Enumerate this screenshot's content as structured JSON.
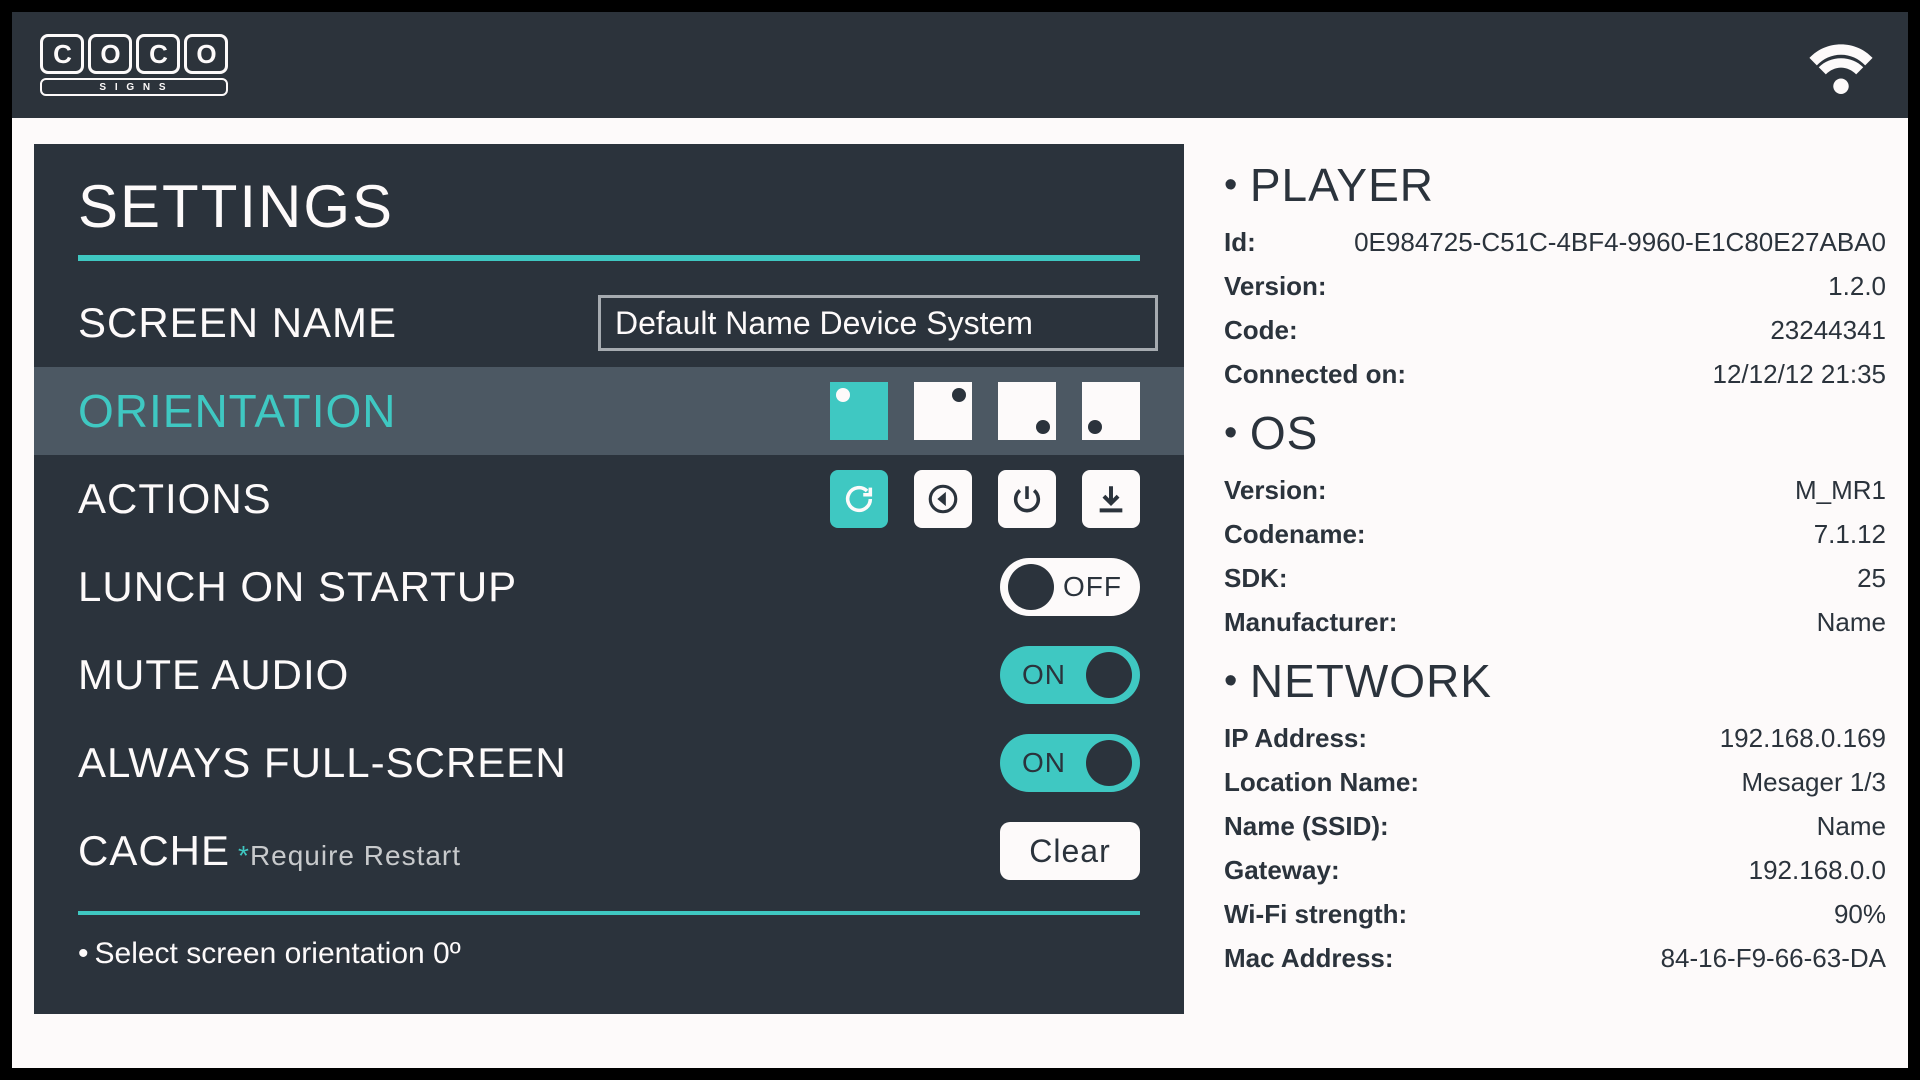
{
  "brand": {
    "letters": [
      "C",
      "O",
      "C",
      "O"
    ],
    "sub": "S I G N S"
  },
  "page": {
    "title": "SETTINGS"
  },
  "screen_name": {
    "label": "SCREEN NAME",
    "value": "Default Name Device System"
  },
  "orientation": {
    "label": "ORIENTATION",
    "selected": 0
  },
  "actions": {
    "label": "ACTIONS"
  },
  "launch": {
    "label": "LUNCH ON STARTUP",
    "state": "OFF"
  },
  "mute": {
    "label": "MUTE AUDIO",
    "state": "ON"
  },
  "fullscreen": {
    "label": "ALWAYS FULL-SCREEN",
    "state": "ON"
  },
  "cache": {
    "label": "CACHE",
    "note": "Require Restart",
    "button": "Clear"
  },
  "hint": "Select screen orientation 0º",
  "toggle_labels": {
    "on": "ON",
    "off": "OFF"
  },
  "info": {
    "player": {
      "heading": "PLAYER",
      "id_k": "Id:",
      "id_v": "0E984725-C51C-4BF4-9960-E1C80E27ABA0",
      "version_k": "Version:",
      "version_v": "1.2.0",
      "code_k": "Code:",
      "code_v": "23244341",
      "connected_k": "Connected on:",
      "connected_v": "12/12/12  21:35"
    },
    "os": {
      "heading": "OS",
      "version_k": "Version:",
      "version_v": "M_MR1",
      "codename_k": "Codename:",
      "codename_v": "7.1.12",
      "sdk_k": "SDK:",
      "sdk_v": "25",
      "manuf_k": "Manufacturer:",
      "manuf_v": "Name"
    },
    "network": {
      "heading": "NETWORK",
      "ip_k": "IP Address:",
      "ip_v": "192.168.0.169",
      "loc_k": "Location Name:",
      "loc_v": "Mesager 1/3",
      "ssid_k": "Name (SSID):",
      "ssid_v": "Name",
      "gw_k": "Gateway:",
      "gw_v": "192.168.0.0",
      "wifi_k": "Wi-Fi strength:",
      "wifi_v": "90%",
      "mac_k": "Mac Address:",
      "mac_v": "84-16-F9-66-63-DA"
    }
  }
}
